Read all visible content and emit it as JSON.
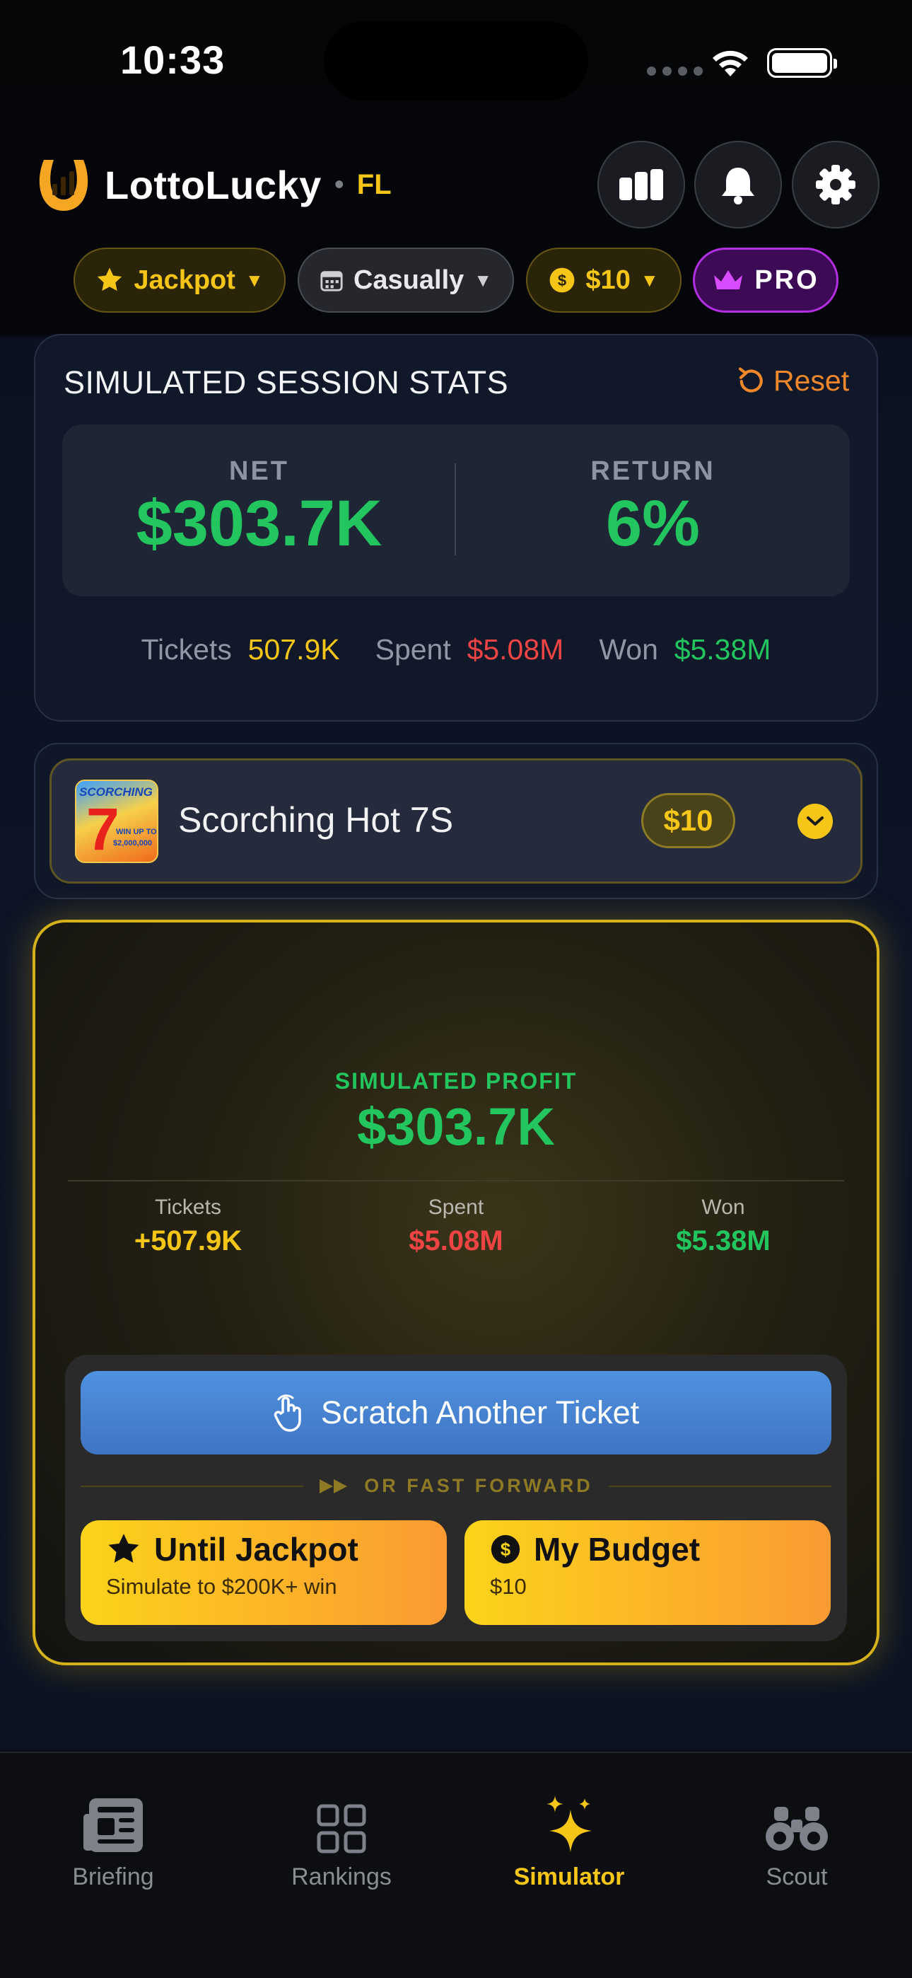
{
  "status_bar": {
    "time": "10:33"
  },
  "header": {
    "app_name": "LottoLucky",
    "state": "FL",
    "icons": [
      "leaderboard-icon",
      "bell-icon",
      "gear-icon"
    ]
  },
  "filters": {
    "mode": "Jackpot",
    "frequency": "Casually",
    "price": "$10",
    "pro": "PRO"
  },
  "session_stats": {
    "title": "SIMULATED SESSION STATS",
    "reset_label": "Reset",
    "net_label": "NET",
    "net_value": "$303.7K",
    "return_label": "RETURN",
    "return_value": "6%",
    "tickets_label": "Tickets",
    "tickets_value": "507.9K",
    "spent_label": "Spent",
    "spent_value": "$5.08M",
    "won_label": "Won",
    "won_value": "$5.38M"
  },
  "game": {
    "name": "Scorching Hot 7S",
    "price": "$10",
    "thumb_title": "SCORCHING",
    "thumb_sub": "WIN UP TO",
    "thumb_amount": "$2,000,000"
  },
  "profit": {
    "label": "SIMULATED PROFIT",
    "value": "$303.7K",
    "tickets_label": "Tickets",
    "tickets_value": "+507.9K",
    "spent_label": "Spent",
    "spent_value": "$5.08M",
    "won_label": "Won",
    "won_value": "$5.38M"
  },
  "actions": {
    "scratch_label": "Scratch Another Ticket",
    "fast_forward_label": "OR FAST FORWARD",
    "until_jackpot_label": "Until Jackpot",
    "until_jackpot_sub": "Simulate to $200K+ win",
    "budget_label": "My Budget",
    "budget_sub": "$10"
  },
  "tabs": [
    {
      "label": "Briefing",
      "active": false
    },
    {
      "label": "Rankings",
      "active": false
    },
    {
      "label": "Simulator",
      "active": true
    },
    {
      "label": "Scout",
      "active": false
    }
  ],
  "colors": {
    "accent_gold": "#f5c518",
    "positive": "#22c55e",
    "negative": "#ef4444",
    "reset": "#f0872b",
    "pro_purple": "#b22fe4",
    "scratch_blue": "#4f92e0"
  }
}
